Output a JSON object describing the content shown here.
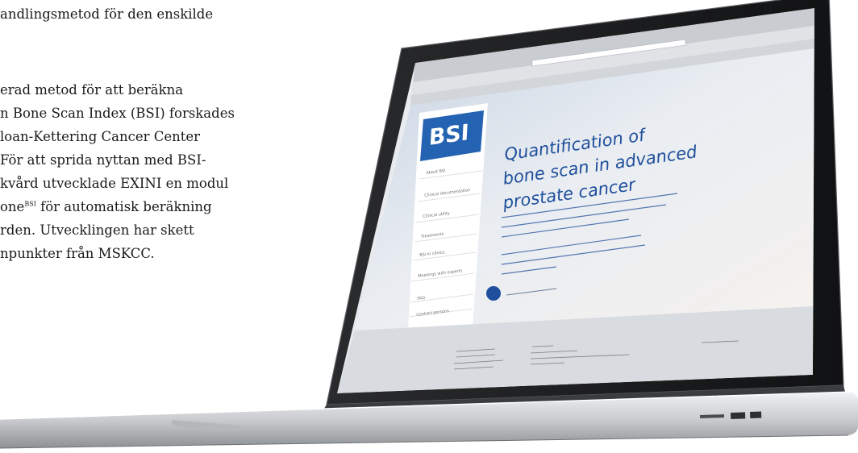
{
  "article": {
    "line1": "andlingsmetod för den enskilde",
    "line2": "erad metod för att beräkna",
    "line3": "n Bone Scan Index (BSI) forskades",
    "line4": "loan-Kettering Cancer Center",
    "line5": "För att sprida nyttan med BSI-",
    "line6": "kvård utvecklade EXINI en modul",
    "line7_pre": "one",
    "line7_sup": "BSI",
    "line7_post": "för automatisk beräkning",
    "line8": "rden. Utvecklingen har skett",
    "line9": "npunkter från MSKCC."
  },
  "screen": {
    "logo": "BSI",
    "headline_1": "Quantification of",
    "headline_2": "bone scan in advanced",
    "headline_3": "prostate cancer",
    "sidebar_items": [
      "About BSI",
      "Clinical documentation",
      "Clinical utility",
      "Treatments",
      "BSI in clinics",
      "Meetings with experts",
      "FAQ",
      "Contact persons"
    ],
    "colors": {
      "accent": "#1f4f9c",
      "page_bg": "#eef0f2",
      "footer_bg": "#d8dbdf",
      "frame": "#1b1c1e",
      "body": "#d4d6d9"
    }
  }
}
